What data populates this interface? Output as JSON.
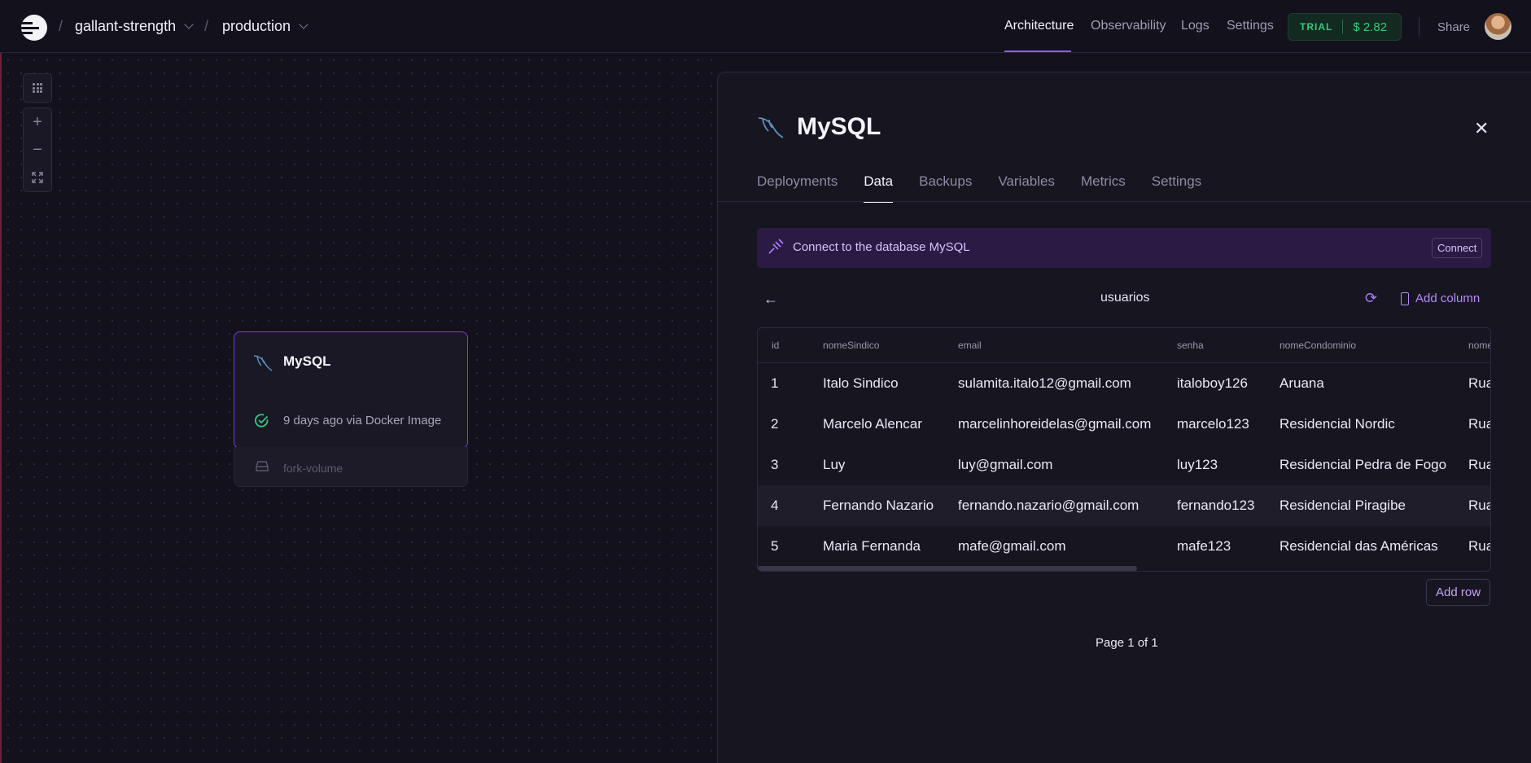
{
  "topbar": {
    "project": "gallant-strength",
    "environment": "production",
    "nav": [
      "Architecture",
      "Observability",
      "Logs",
      "Settings"
    ],
    "active_nav": "Architecture",
    "trial_label": "TRIAL",
    "trial_amount": "$ 2.82",
    "share": "Share"
  },
  "canvas": {
    "zoom_in": "+",
    "zoom_out": "−",
    "service": {
      "name": "MySQL",
      "status": "9 days ago via Docker Image",
      "volume": "fork-volume"
    }
  },
  "panel": {
    "title": "MySQL",
    "tabs": [
      "Deployments",
      "Data",
      "Backups",
      "Variables",
      "Metrics",
      "Settings"
    ],
    "active_tab": "Data",
    "banner_text": "Connect to the database MySQL",
    "connect_label": "Connect",
    "table_name": "usuarios",
    "add_column": "Add column",
    "columns": [
      "id",
      "nomeSindico",
      "email",
      "senha",
      "nomeCondominio",
      "nome"
    ],
    "rows": [
      [
        "1",
        "Italo Sindico",
        "sulamita.italo12@gmail.com",
        "italoboy126",
        "Aruana",
        "Rua"
      ],
      [
        "2",
        "Marcelo Alencar",
        "marcelinhoreidelas@gmail.com",
        "marcelo123",
        "Residencial Nordic",
        "Rua"
      ],
      [
        "3",
        "Luy",
        "luy@gmail.com",
        "luy123",
        "Residencial Pedra de Fogo",
        "Rua"
      ],
      [
        "4",
        "Fernando Nazario",
        "fernando.nazario@gmail.com",
        "fernando123",
        "Residencial Piragibe",
        "Rua"
      ],
      [
        "5",
        "Maria Fernanda",
        "mafe@gmail.com",
        "mafe123",
        "Residencial das Américas",
        "Rua"
      ]
    ],
    "add_row": "Add row",
    "pagination": "Page 1 of 1"
  },
  "colors": {
    "background": "#13111c",
    "accent": "#8b5cf6",
    "trial_green": "#36c880",
    "banner_bg": "#2b1b44"
  }
}
